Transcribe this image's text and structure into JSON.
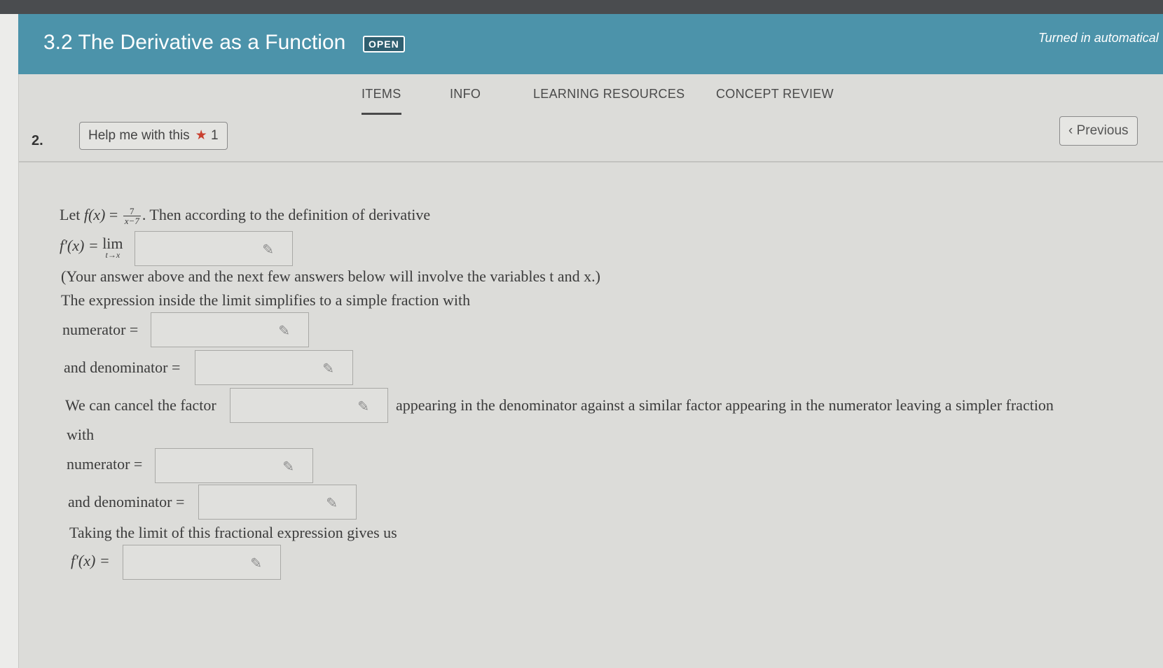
{
  "header": {
    "title": "3.2 The Derivative as a Function",
    "badge": "OPEN",
    "status": "Turned in automatical"
  },
  "tabs": [
    {
      "label": "ITEMS",
      "active": true
    },
    {
      "label": "INFO"
    },
    {
      "label": "LEARNING RESOURCES"
    },
    {
      "label": "CONCEPT REVIEW"
    }
  ],
  "question": {
    "number": "2.",
    "help_label": "Help me with this",
    "help_count": "1",
    "previous_label": "Previous"
  },
  "problem": {
    "let_prefix": "Let ",
    "f_of_x": "f(x)",
    "equals": " = ",
    "frac_num": "7",
    "frac_den": "x−7",
    "intro_suffix": ". Then according to the definition of derivative",
    "fprime_lhs": "f′(x) = ",
    "lim_word": "lim",
    "lim_sub": "t→x",
    "note": "(Your answer above and the next few answers below will involve the variables t and x.)",
    "simplifies": "The expression inside the limit simplifies to a simple fraction with",
    "numerator_label": "numerator =",
    "denominator_label": "and denominator =",
    "cancel_prefix": "We can cancel the factor",
    "cancel_suffix": "appearing in the denominator against a similar factor appearing in the numerator leaving a simpler fraction",
    "with_word": "with",
    "numerator_label2": "numerator =",
    "denominator_label2": "and denominator =",
    "taking_limit": "Taking the limit of this fractional expression gives us",
    "fprime_final": "f′(x) ="
  },
  "icons": {
    "pencil": "✎",
    "star": "★",
    "chevron_left": "‹"
  }
}
